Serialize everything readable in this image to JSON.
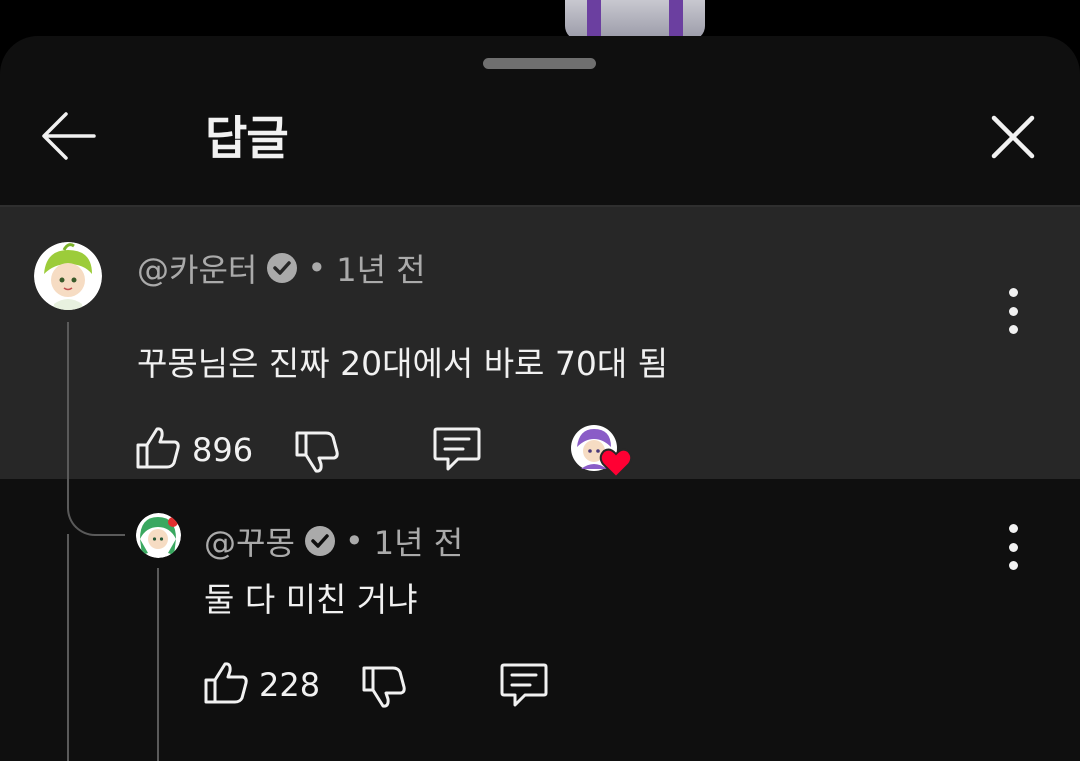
{
  "panel": {
    "title": "답글"
  },
  "main_comment": {
    "author": "@카운터",
    "time": "1년 전",
    "text": "꾸몽님은 진짜 20대에서 바로 70대 됨",
    "likes": "896",
    "creator_hearted": true
  },
  "reply": {
    "author": "@꾸몽",
    "time": "1년 전",
    "text": "둘 다 미친 거냐",
    "likes": "228"
  },
  "colors": {
    "sheet_bg": "#0f0f0f",
    "highlight_bg": "#272727",
    "heart": "#ff0033"
  }
}
